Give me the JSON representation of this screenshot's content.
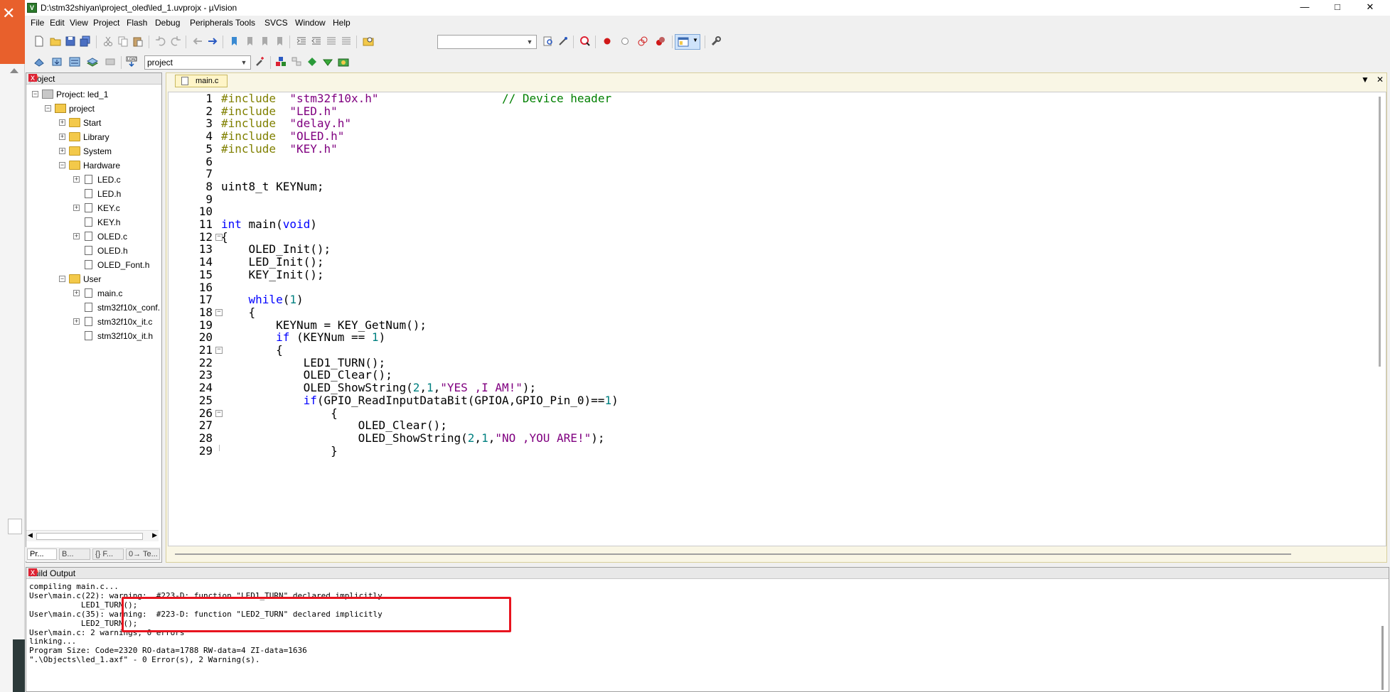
{
  "window": {
    "title": "D:\\stm32shiyan\\project_oled\\led_1.uvprojx - µVision",
    "controls": {
      "minimize": "—",
      "maximize": "□",
      "close": "✕"
    }
  },
  "menu": [
    "File",
    "Edit",
    "View",
    "Project",
    "Flash",
    "Debug",
    "Peripherals",
    "Tools",
    "SVCS",
    "Window",
    "Help"
  ],
  "toolbar2": {
    "target": "project"
  },
  "project_panel": {
    "title": "Project",
    "tree": {
      "root": "Project: led_1",
      "target": "project",
      "groups": [
        "Start",
        "Library",
        "System",
        "Hardware"
      ],
      "hardware_files": [
        "LED.c",
        "LED.h",
        "KEY.c",
        "KEY.h",
        "OLED.c",
        "OLED.h",
        "OLED_Font.h"
      ],
      "user_group": "User",
      "user_files": [
        "main.c",
        "stm32f10x_conf.",
        "stm32f10x_it.c",
        "stm32f10x_it.h"
      ]
    },
    "tabs": [
      "Pr...",
      "B...",
      "{} F...",
      "0→ Te..."
    ]
  },
  "editor": {
    "tab": "main.c",
    "lines": [
      {
        "n": "1",
        "parts": [
          [
            "pp",
            "#include  "
          ],
          [
            "str",
            "\"stm32f10x.h\""
          ],
          [
            "pl",
            "                  "
          ],
          [
            "cm",
            "// Device header"
          ]
        ]
      },
      {
        "n": "2",
        "parts": [
          [
            "pp",
            "#include  "
          ],
          [
            "str",
            "\"LED.h\""
          ]
        ]
      },
      {
        "n": "3",
        "parts": [
          [
            "pp",
            "#include  "
          ],
          [
            "str",
            "\"delay.h\""
          ]
        ]
      },
      {
        "n": "4",
        "parts": [
          [
            "pp",
            "#include  "
          ],
          [
            "str",
            "\"OLED.h\""
          ]
        ]
      },
      {
        "n": "5",
        "parts": [
          [
            "pp",
            "#include  "
          ],
          [
            "str",
            "\"KEY.h\""
          ]
        ]
      },
      {
        "n": "6",
        "parts": []
      },
      {
        "n": "7",
        "parts": []
      },
      {
        "n": "8",
        "parts": [
          [
            "pl",
            "uint8_t KEYNum;"
          ]
        ]
      },
      {
        "n": "9",
        "parts": []
      },
      {
        "n": "10",
        "parts": []
      },
      {
        "n": "11",
        "parts": [
          [
            "kw",
            "int"
          ],
          [
            "pl",
            " main("
          ],
          [
            "kw",
            "void"
          ],
          [
            "pl",
            ")"
          ]
        ]
      },
      {
        "n": "12",
        "fold": "open",
        "parts": [
          [
            "pl",
            "{"
          ]
        ]
      },
      {
        "n": "13",
        "parts": [
          [
            "pl",
            "    OLED_Init();"
          ]
        ]
      },
      {
        "n": "14",
        "parts": [
          [
            "pl",
            "    LED_Init();"
          ]
        ]
      },
      {
        "n": "15",
        "parts": [
          [
            "pl",
            "    KEY_Init();"
          ]
        ]
      },
      {
        "n": "16",
        "parts": []
      },
      {
        "n": "17",
        "parts": [
          [
            "pl",
            "    "
          ],
          [
            "kw",
            "while"
          ],
          [
            "pl",
            "("
          ],
          [
            "nm",
            "1"
          ],
          [
            "pl",
            ")"
          ]
        ]
      },
      {
        "n": "18",
        "fold": "open",
        "parts": [
          [
            "pl",
            "    {"
          ]
        ]
      },
      {
        "n": "19",
        "parts": [
          [
            "pl",
            "        KEYNum = KEY_GetNum();"
          ]
        ]
      },
      {
        "n": "20",
        "parts": [
          [
            "pl",
            "        "
          ],
          [
            "kw",
            "if"
          ],
          [
            "pl",
            " (KEYNum == "
          ],
          [
            "nm",
            "1"
          ],
          [
            "pl",
            ")"
          ]
        ]
      },
      {
        "n": "21",
        "fold": "open",
        "parts": [
          [
            "pl",
            "        {"
          ]
        ]
      },
      {
        "n": "22",
        "parts": [
          [
            "pl",
            "            LED1_TURN();"
          ]
        ]
      },
      {
        "n": "23",
        "parts": [
          [
            "pl",
            "            OLED_Clear();"
          ]
        ]
      },
      {
        "n": "24",
        "parts": [
          [
            "pl",
            "            OLED_ShowString("
          ],
          [
            "nm",
            "2"
          ],
          [
            "pl",
            ","
          ],
          [
            "nm",
            "1"
          ],
          [
            "pl",
            ","
          ],
          [
            "str",
            "\"YES ,I AM!\""
          ],
          [
            "pl",
            ");"
          ]
        ]
      },
      {
        "n": "25",
        "parts": [
          [
            "pl",
            "            "
          ],
          [
            "kw",
            "if"
          ],
          [
            "pl",
            "(GPIO_ReadInputDataBit(GPIOA,GPIO_Pin_0)=="
          ],
          [
            "nm",
            "1"
          ],
          [
            "pl",
            ")"
          ]
        ]
      },
      {
        "n": "26",
        "fold": "open",
        "parts": [
          [
            "pl",
            "                {"
          ]
        ]
      },
      {
        "n": "27",
        "parts": [
          [
            "pl",
            "                    OLED_Clear();"
          ]
        ]
      },
      {
        "n": "28",
        "parts": [
          [
            "pl",
            "                    OLED_ShowString("
          ],
          [
            "nm",
            "2"
          ],
          [
            "pl",
            ","
          ],
          [
            "nm",
            "1"
          ],
          [
            "pl",
            ","
          ],
          [
            "str",
            "\"NO ,YOU ARE!\""
          ],
          [
            "pl",
            ");"
          ]
        ]
      },
      {
        "n": "29",
        "fold": "end",
        "parts": [
          [
            "pl",
            "                }"
          ]
        ]
      }
    ]
  },
  "build_output": {
    "title": "Build Output",
    "lines": [
      "compiling main.c...",
      "User\\main.c(22): warning:  #223-D: function \"LED1_TURN\" declared implicitly",
      "           LED1_TURN();",
      "User\\main.c(35): warning:  #223-D: function \"LED2_TURN\" declared implicitly",
      "           LED2_TURN();",
      "User\\main.c: 2 warnings, 0 errors",
      "linking...",
      "Program Size: Code=2320 RO-data=1788 RW-data=4 ZI-data=1636",
      "\".\\Objects\\led_1.axf\" - 0 Error(s), 2 Warning(s)."
    ]
  }
}
